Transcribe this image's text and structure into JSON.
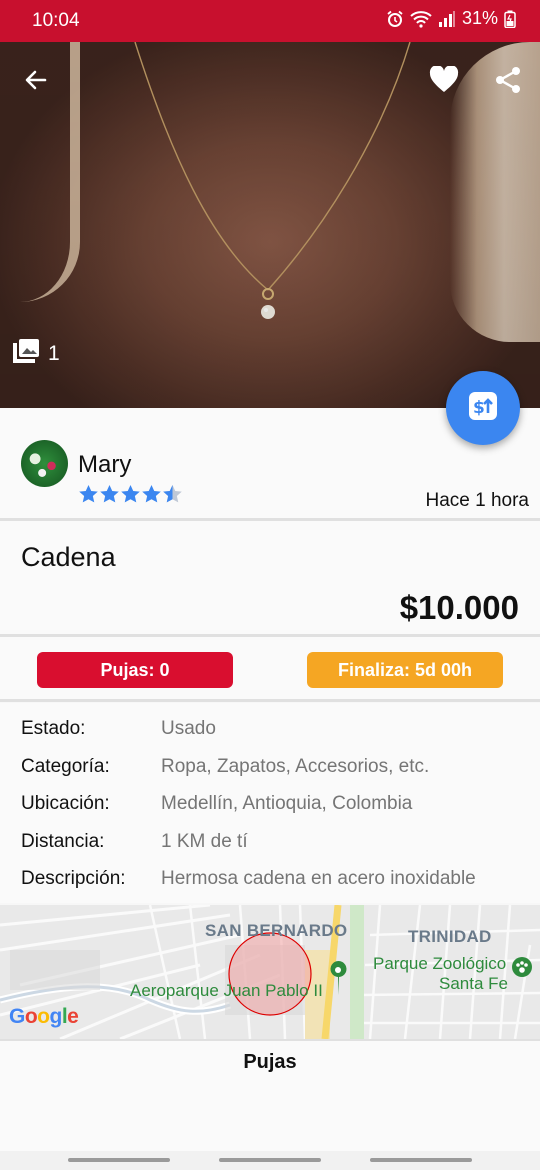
{
  "status_bar": {
    "time": "10:04",
    "battery": "31%"
  },
  "photo": {
    "count": "1",
    "icons": [
      "back-arrow-icon",
      "heart-icon",
      "share-icon",
      "gallery-icon"
    ]
  },
  "fab": {
    "icon": "bid-money-icon",
    "color": "#3b86f0"
  },
  "seller": {
    "name": "Mary",
    "rating": 4.5,
    "rating_max": 5,
    "posted": "Hace 1 hora"
  },
  "item": {
    "title": "Cadena",
    "price": "$10.000"
  },
  "badges": {
    "bids": "Pujas: 0",
    "ends": "Finaliza: 5d 00h",
    "bids_color": "#d90e2f",
    "ends_color": "#f5a623"
  },
  "details": [
    {
      "label": "Estado:",
      "value": "Usado"
    },
    {
      "label": "Categoría:",
      "value": "Ropa, Zapatos, Accesorios, etc."
    },
    {
      "label": "Ubicación:",
      "value": "Medellín, Antioquia, Colombia"
    },
    {
      "label": "Distancia:",
      "value": "1 KM de tí"
    },
    {
      "label": "Descripción:",
      "value": "Hermosa cadena en acero inoxidable"
    }
  ],
  "map": {
    "labels": {
      "san_bernardo": "SAN BERNARDO",
      "trinidad": "TRINIDAD",
      "aeroparque": "Aeroparque Juan Pablo II",
      "zoo_line1": "Parque Zoológico",
      "zoo_line2": "Santa Fe"
    },
    "logo": "Google"
  },
  "bids_section": {
    "title": "Pujas"
  }
}
